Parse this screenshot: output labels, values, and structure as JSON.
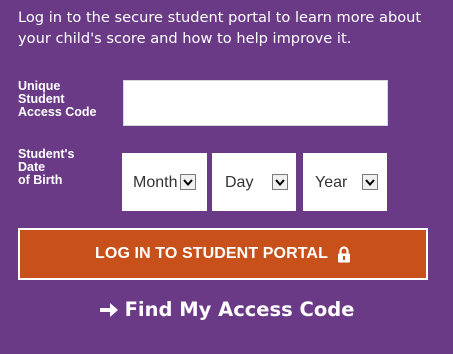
{
  "intro": {
    "text": "Log in to the secure student portal to learn more about your child's score and how to help improve it."
  },
  "access_code": {
    "label": "Unique\nStudent\nAccess Code",
    "value": "",
    "placeholder": ""
  },
  "dob": {
    "label": "Student's\nDate\nof Birth",
    "month": {
      "selected": "Month"
    },
    "day": {
      "selected": "Day"
    },
    "year": {
      "selected": "Year"
    }
  },
  "login_button": {
    "label": "LOG IN TO STUDENT PORTAL",
    "icon": "lock-icon"
  },
  "find_link": {
    "label": "Find My Access Code",
    "icon": "arrow-right-icon"
  },
  "colors": {
    "background": "#6a3a87",
    "button": "#c8501b",
    "text": "#ffffff"
  }
}
